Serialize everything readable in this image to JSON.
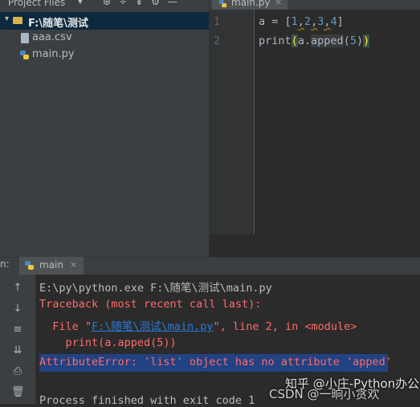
{
  "project_panel": {
    "title": "Project Files",
    "dropdown_glyph": "▼",
    "tools": [
      "⊕",
      "÷",
      "⇟",
      "⚙",
      "—"
    ],
    "root_label": "F:\\随笔\\测试",
    "root_arrow": "▾",
    "files": [
      {
        "name": "aaa.csv",
        "icon": "csv-file-icon"
      },
      {
        "name": "main.py",
        "icon": "python-file-icon"
      }
    ]
  },
  "editor": {
    "tab_label": "main.py",
    "tab_close": "×",
    "line_numbers": [
      "1",
      "2"
    ],
    "line1": {
      "a": "a = [",
      "n1": "1",
      "c1": ",",
      "n2": "2",
      "c2": ",",
      "n3": "3",
      "c3": ",",
      "n4": "4",
      "end": "]"
    },
    "line2": {
      "func": "print",
      "open": "(",
      "obj": "a.",
      "attr": "apped",
      "args": "(",
      "num": "5",
      "close": ")",
      "outer_close": ")"
    }
  },
  "run_panel": {
    "label": "n:",
    "tab_label": "main",
    "tab_close": "×",
    "toolbar_icons": [
      "↑",
      "↓",
      "≡",
      "⇊",
      "⎙",
      "🗑"
    ],
    "console_lines": {
      "cmd": "E:\\py\\python.exe F:\\随笔\\测试\\main.py",
      "traceback": "Traceback (most recent call last):",
      "file_prefix": "  File \"",
      "file_link": "F:\\随笔\\测试\\main.py",
      "file_suffix": "\", line 2, in <module>",
      "code": "    print(a.apped(5))",
      "error": "AttributeError: 'list' object has no attribute 'apped'",
      "exit": "Process finished with exit code 1"
    }
  },
  "watermarks": {
    "line1": "知乎 @小庄-Python办公",
    "line2": "CSDN @一晌小贪欢"
  },
  "colors": {
    "bg": "#2b2b2b",
    "panel": "#3c3f41",
    "error_text": "#ff6b68",
    "link": "#287bde",
    "selection": "#214283",
    "number": "#6897bb"
  }
}
